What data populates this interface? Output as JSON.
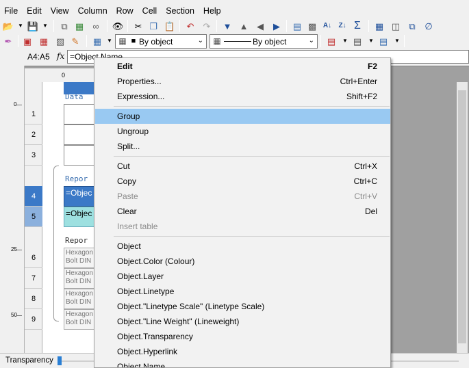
{
  "menubar": [
    "File",
    "Edit",
    "View",
    "Column",
    "Row",
    "Cell",
    "Section",
    "Help"
  ],
  "toolbar": {
    "fill_select": "By object",
    "line_select": "By object"
  },
  "formula_bar": {
    "cell_ref": "A4:A5",
    "fx": "fx",
    "value": "=Object.Name"
  },
  "sheet": {
    "ruler_top": "0",
    "ruler_left": [
      "0",
      "25",
      "50"
    ],
    "rows": [
      "1",
      "2",
      "3",
      "4",
      "5",
      "6",
      "7",
      "8",
      "9"
    ],
    "sections": [
      "Data",
      "Repor",
      "Repor"
    ],
    "cell4": "=Objec",
    "cell5": "=Objec",
    "hex_line1": "Hexagon",
    "hex_line2": "Bolt DIN"
  },
  "status": {
    "label": "Transparency"
  },
  "context_menu": {
    "items": [
      {
        "label": "Edit",
        "shortcut": "F2"
      },
      {
        "label": "Properties...",
        "shortcut": "Ctrl+Enter"
      },
      {
        "label": "Expression...",
        "shortcut": "Shift+F2"
      },
      {
        "label": "Group",
        "shortcut": ""
      },
      {
        "label": "Ungroup",
        "shortcut": ""
      },
      {
        "label": "Split...",
        "shortcut": ""
      },
      {
        "label": "Cut",
        "shortcut": "Ctrl+X"
      },
      {
        "label": "Copy",
        "shortcut": "Ctrl+C"
      },
      {
        "label": "Paste",
        "shortcut": "Ctrl+V"
      },
      {
        "label": "Clear",
        "shortcut": "Del"
      },
      {
        "label": "Insert table",
        "shortcut": ""
      },
      {
        "label": "Object",
        "shortcut": ""
      },
      {
        "label": "Object.Color (Colour)",
        "shortcut": ""
      },
      {
        "label": "Object.Layer",
        "shortcut": ""
      },
      {
        "label": "Object.Linetype",
        "shortcut": ""
      },
      {
        "label": "Object.\"Linetype Scale\" (Linetype Scale)",
        "shortcut": ""
      },
      {
        "label": "Object.\"Line Weight\" (Lineweight)",
        "shortcut": ""
      },
      {
        "label": "Object.Transparency",
        "shortcut": ""
      },
      {
        "label": "Object.Hyperlink",
        "shortcut": ""
      },
      {
        "label": "Object.Name",
        "shortcut": ""
      }
    ]
  }
}
